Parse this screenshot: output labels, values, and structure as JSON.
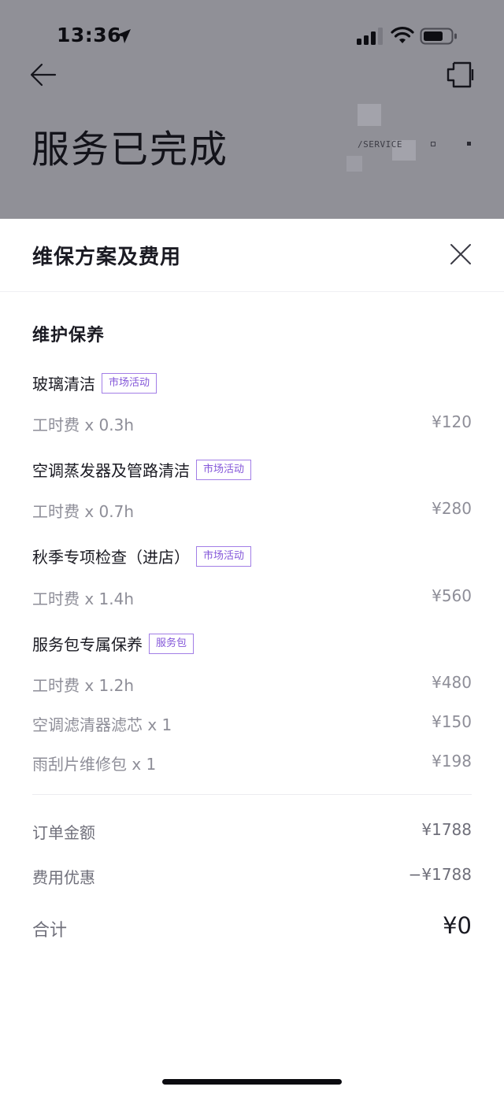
{
  "status_bar": {
    "time": "13:36",
    "icons": [
      "location-arrow-icon",
      "cellular-signal-icon",
      "wifi-icon",
      "battery-icon"
    ]
  },
  "background_page": {
    "title": "服务已完成",
    "service_label": "/SERVICE",
    "icons": [
      "back-arrow-icon",
      "device-icon"
    ]
  },
  "sheet": {
    "title": "维保方案及费用",
    "close_icon": "close-icon",
    "section_title": "维护保养",
    "groups": [
      {
        "name": "玻璃清洁",
        "tag": "市场活动",
        "items": [
          {
            "label": "工时费 x 0.3h",
            "amount": "¥120"
          }
        ]
      },
      {
        "name": "空调蒸发器及管路清洁",
        "tag": "市场活动",
        "items": [
          {
            "label": "工时费 x 0.7h",
            "amount": "¥280"
          }
        ]
      },
      {
        "name": "秋季专项检查（进店）",
        "tag": "市场活动",
        "items": [
          {
            "label": "工时费 x 1.4h",
            "amount": "¥560"
          }
        ]
      },
      {
        "name": "服务包专属保养",
        "tag": "服务包",
        "items": [
          {
            "label": "工时费 x 1.2h",
            "amount": "¥480"
          },
          {
            "label": "空调滤清器滤芯 x 1",
            "amount": "¥150"
          },
          {
            "label": "雨刮片维修包 x 1",
            "amount": "¥198"
          }
        ]
      }
    ],
    "summary": {
      "order_amount_label": "订单金额",
      "order_amount": "¥1788",
      "discount_label": "费用优惠",
      "discount": "−¥1788",
      "total_label": "合计",
      "total": "¥0"
    }
  },
  "colors": {
    "tag_border": "#a27ee6",
    "tag_text": "#8457d9",
    "backdrop": "#909097",
    "muted_text": "#8e8e98"
  }
}
